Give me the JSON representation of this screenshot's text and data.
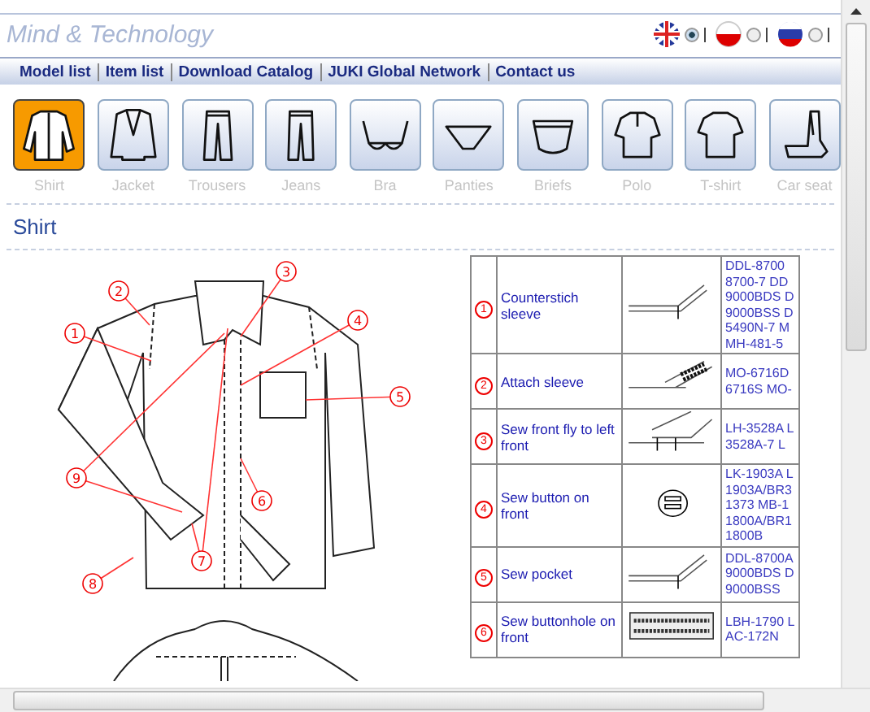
{
  "header": {
    "title": "Mind & Technology"
  },
  "languages": [
    {
      "kind": "uk",
      "selected": true
    },
    {
      "kind": "pl",
      "selected": false
    },
    {
      "kind": "ru",
      "selected": false
    }
  ],
  "nav": [
    "Model list",
    "Item list",
    "Download Catalog",
    "JUKI Global Network",
    "Contact us"
  ],
  "categories": [
    {
      "kind": "shirt",
      "label": "Shirt",
      "selected": true
    },
    {
      "kind": "jacket",
      "label": "Jacket",
      "selected": false
    },
    {
      "kind": "trousers",
      "label": "Trousers",
      "selected": false
    },
    {
      "kind": "jeans",
      "label": "Jeans",
      "selected": false
    },
    {
      "kind": "bra",
      "label": "Bra",
      "selected": false
    },
    {
      "kind": "panties",
      "label": "Panties",
      "selected": false
    },
    {
      "kind": "briefs",
      "label": "Briefs",
      "selected": false
    },
    {
      "kind": "polo",
      "label": "Polo",
      "selected": false
    },
    {
      "kind": "tshirt",
      "label": "T-shirt",
      "selected": false
    },
    {
      "kind": "carseat",
      "label": "Car seat",
      "selected": false
    }
  ],
  "section_title": "Shirt",
  "callouts": [
    "1",
    "2",
    "3",
    "4",
    "5",
    "6",
    "7",
    "8",
    "9"
  ],
  "rows": [
    {
      "number": "1",
      "process": "Counterstich sleeve",
      "kind": "seam",
      "models": [
        "DDL-8700",
        "8700-7 DD",
        "9000BDS D",
        "9000BSS D",
        "5490N-7 M",
        "MH-481-5"
      ]
    },
    {
      "number": "2",
      "process": "Attach sleeve",
      "kind": "overlock",
      "models": [
        "MO-6716D",
        "6716S MO-"
      ]
    },
    {
      "number": "3",
      "process": "Sew front fly to left front",
      "kind": "fly",
      "models": [
        "LH-3528A L",
        "3528A-7 L"
      ]
    },
    {
      "number": "4",
      "process": "Sew button on front",
      "kind": "button",
      "models": [
        "LK-1903A L",
        "1903A/BR3",
        "1373 MB-1",
        "1800A/BR1",
        "1800B"
      ]
    },
    {
      "number": "5",
      "process": "Sew pocket",
      "kind": "seam",
      "models": [
        "DDL-8700A",
        "9000BDS D",
        "9000BSS"
      ]
    },
    {
      "number": "6",
      "process": "Sew buttonhole on front",
      "kind": "buttonhole",
      "models": [
        "LBH-1790 L",
        "AC-172N"
      ]
    }
  ]
}
